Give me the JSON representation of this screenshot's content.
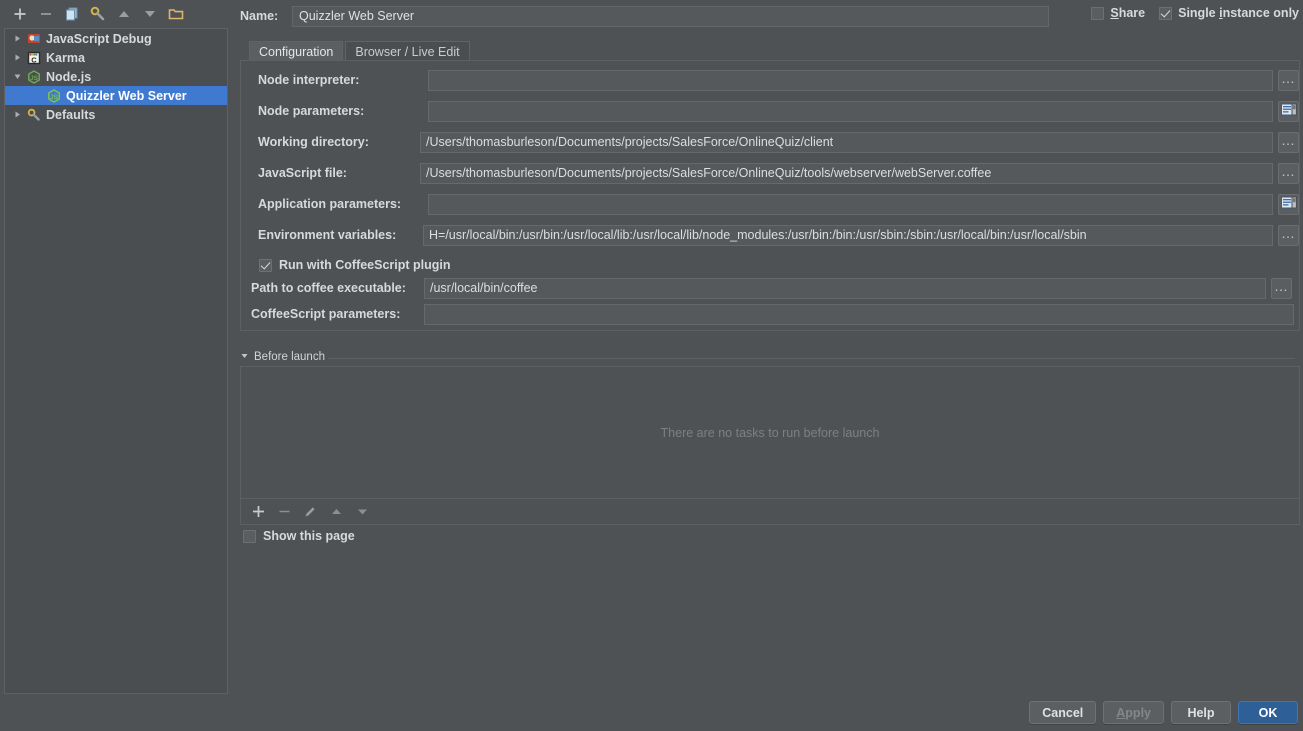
{
  "window": {
    "name_label": "Name:",
    "name_value": "Quizzler Web Server"
  },
  "tree_toolbar": {
    "buttons": [
      {
        "name": "add-configuration-button",
        "icon": "plus-icon",
        "label": "+"
      },
      {
        "name": "remove-configuration-button",
        "icon": "minus-icon",
        "label": "−"
      },
      {
        "name": "copy-configuration-button",
        "icon": "copy-icon",
        "label": "Copy Configuration"
      },
      {
        "name": "edit-defaults-button",
        "icon": "wrench-icon",
        "label": "Edit defaults"
      },
      {
        "name": "move-up-button",
        "icon": "arrow-up-icon",
        "label": "Move Up"
      },
      {
        "name": "move-down-button",
        "icon": "arrow-down-icon",
        "label": "Move Down"
      },
      {
        "name": "create-folder-button",
        "icon": "folder-icon",
        "label": "Create Folder"
      }
    ]
  },
  "tree": {
    "items": [
      {
        "label": "JavaScript Debug",
        "icon": "javascript-debug-icon",
        "expanded": false,
        "level": 1,
        "selected": false
      },
      {
        "label": "Karma",
        "icon": "karma-icon",
        "expanded": false,
        "level": 1,
        "selected": false
      },
      {
        "label": "Node.js",
        "icon": "nodejs-icon",
        "expanded": true,
        "level": 1,
        "selected": false
      },
      {
        "label": "Quizzler Web Server",
        "icon": "nodejs-icon",
        "expanded": null,
        "level": 2,
        "selected": true
      },
      {
        "label": "Defaults",
        "icon": "wrench-icon",
        "expanded": false,
        "level": 1,
        "selected": false
      }
    ]
  },
  "top_options": {
    "share": {
      "label": "Share",
      "mnemonic": "S",
      "checked": false
    },
    "single_instance": {
      "label": "Single instance only",
      "mnemonic": "i",
      "checked": true
    }
  },
  "tabs": [
    {
      "label": "Configuration",
      "active": true
    },
    {
      "label": "Browser / Live Edit",
      "active": false
    }
  ],
  "configuration": {
    "fields": [
      {
        "label": "Node interpreter:",
        "value": "",
        "button": "browse-ellipsis"
      },
      {
        "label": "Node parameters:",
        "value": "",
        "button": "expand-editor"
      },
      {
        "label": "Working directory:",
        "value": "/Users/thomasburleson/Documents/projects/SalesForce/OnlineQuiz/client",
        "button": "browse-ellipsis"
      },
      {
        "label": "JavaScript file:",
        "value": "/Users/thomasburleson/Documents/projects/SalesForce/OnlineQuiz/tools/webserver/webServer.coffee",
        "button": "browse-ellipsis"
      },
      {
        "label": "Application parameters:",
        "value": "",
        "button": "expand-editor"
      },
      {
        "label": "Environment variables:",
        "value": "H=/usr/local/bin:/usr/bin:/usr/local/lib:/usr/local/lib/node_modules:/usr/bin:/bin:/usr/sbin:/sbin:/usr/local/bin:/usr/local/sbin",
        "button": "browse-ellipsis"
      }
    ],
    "coffeescript": {
      "run_plugin": {
        "label": "Run with CoffeeScript plugin",
        "checked": true
      },
      "path_label": "Path to coffee executable:",
      "path_value": "/usr/local/bin/coffee",
      "params_label": "CoffeeScript parameters:",
      "params_value": ""
    }
  },
  "before_launch": {
    "title": "Before launch",
    "expanded": true,
    "empty_message": "There are no tasks to run before launch",
    "toolbar": [
      {
        "name": "add-task-button",
        "icon": "plus-icon"
      },
      {
        "name": "remove-task-button",
        "icon": "minus-icon"
      },
      {
        "name": "edit-task-button",
        "icon": "pencil-icon"
      },
      {
        "name": "move-task-up-button",
        "icon": "arrow-up-icon"
      },
      {
        "name": "move-task-down-button",
        "icon": "arrow-down-icon"
      }
    ],
    "show_this_page": {
      "label": "Show this page",
      "checked": false
    }
  },
  "dialog_buttons": [
    {
      "label": "Cancel",
      "name": "cancel-button",
      "state": "normal"
    },
    {
      "label": "Apply",
      "name": "apply-button",
      "state": "disabled",
      "mnemonic": "A"
    },
    {
      "label": "Help",
      "name": "help-button",
      "state": "normal"
    },
    {
      "label": "OK",
      "name": "ok-button",
      "state": "primary"
    }
  ],
  "colors": {
    "background": "#4e5255",
    "panel": "#4a4e51",
    "selection": "#3f7ad0",
    "primary_button": "#2f5f97",
    "text": "#d7d9da",
    "muted_text": "#7c8083"
  }
}
